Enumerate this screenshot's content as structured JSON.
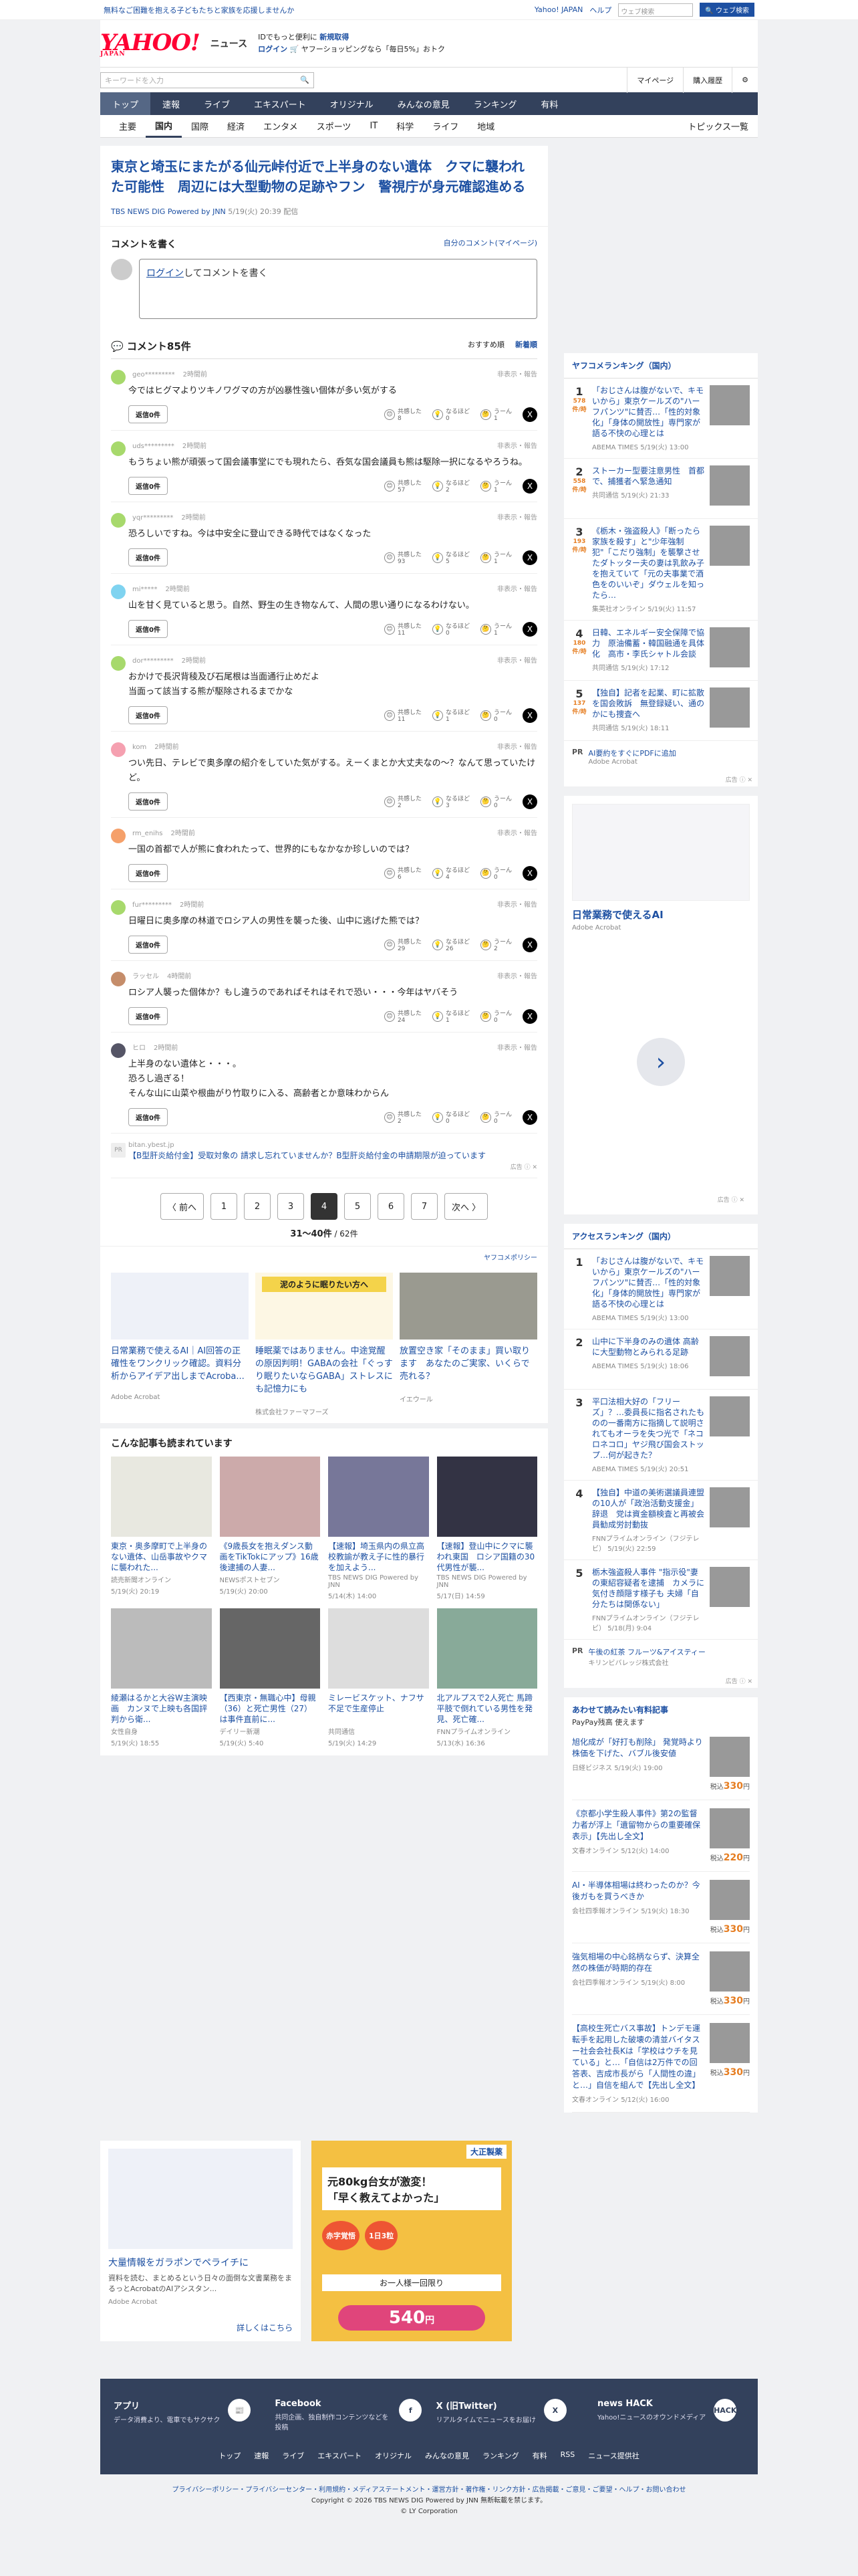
{
  "topstrip": {
    "promo": "無料なご困難を抱える子どもたちと家族を応援しませんか",
    "links": [
      "Yahoo! JAPAN",
      "ヘルプ"
    ],
    "search_placeholder": "ウェブ検索",
    "search_button": "🔍 ウェブ検索"
  },
  "masthead": {
    "logo": "YAHOO!",
    "logo_sub": "JAPAN",
    "service": "ニュース",
    "promo_line1_a": "IDでもっと便利に",
    "promo_line1_b": "新規取得",
    "promo_line2_a": "ログイン",
    "promo_line2_b": "🛒 ヤフーショッピングなら「毎日5%」おトク"
  },
  "subbar": {
    "keyword_placeholder": "キーワードを入力",
    "mypage": "マイページ",
    "purchase": "購入履歴"
  },
  "gnav": [
    "トップ",
    "速報",
    "ライブ",
    "エキスパート",
    "オリジナル",
    "みんなの意見",
    "ランキング",
    "有料"
  ],
  "cnav": {
    "items": [
      "主要",
      "国内",
      "国際",
      "経済",
      "エンタメ",
      "スポーツ",
      "IT",
      "科学",
      "ライフ",
      "地域"
    ],
    "topics_list": "トピックス一覧"
  },
  "article": {
    "title": "東京と埼玉にまたがる仙元峠付近で上半身のない遺体　クマに襲われた可能性　周辺には大型動物の足跡やフン　警視庁が身元確認進める",
    "source": "TBS NEWS DIG Powered by JNN",
    "date": "5/19(火) 20:39 配信"
  },
  "comment_form": {
    "heading": "コメントを書く",
    "own_link": "自分のコメント(マイページ)",
    "login": "ログイン",
    "placeholder_rest": "してコメントを書く"
  },
  "comments_header": {
    "title": "コメント85件",
    "sort_recommended": "おすすめ順",
    "sort_newest": "新着順"
  },
  "comments": [
    {
      "user": "geo*********",
      "age": "2時間前",
      "text": "今ではヒグマよりツキノワグマの方が凶暴性強い個体が多い気がする",
      "agree": "8",
      "naruhodo": "0",
      "umm": "1",
      "color": "#a7d96c"
    },
    {
      "user": "uds*********",
      "age": "2時間前",
      "text": "もうちょい熊が頑張って国会議事堂にでも現れたら、呑気な国会議員も熊は駆除一択になるやろうね。",
      "agree": "57",
      "naruhodo": "2",
      "umm": "1",
      "color": "#a7d96c"
    },
    {
      "user": "yqr*********",
      "age": "2時間前",
      "text": "恐ろしいですね。今は中安全に登山できる時代ではなくなった",
      "agree": "93",
      "naruhodo": "5",
      "umm": "1",
      "color": "#a7d96c"
    },
    {
      "user": "mi*****",
      "age": "2時間前",
      "text": "山を甘く見ていると思う。自然、野生の生き物なんて、人間の思い通りになるわけない。",
      "agree": "11",
      "naruhodo": "0",
      "umm": "1",
      "color": "#7fd3f0"
    },
    {
      "user": "dor*********",
      "age": "2時間前",
      "text": "おかけで長沢背稜及び石尾根は当面通行止めだよ\n当面って該当する熊が駆除されるまでかな",
      "agree": "11",
      "naruhodo": "1",
      "umm": "0",
      "color": "#a7d96c"
    },
    {
      "user": "kom",
      "age": "2時間前",
      "text": "つい先日、テレビで奥多摩の紹介をしていた気がする。えーくまとか大丈夫なの〜？なんて思っていたけど。",
      "agree": "2",
      "naruhodo": "3",
      "umm": "0",
      "color": "#f5a0b0"
    },
    {
      "user": "rm_enihs",
      "age": "2時間前",
      "text": "一国の首都で人が熊に食われたって、世界的にもなかなか珍しいのでは？",
      "agree": "6",
      "naruhodo": "4",
      "umm": "0",
      "color": "#f5a06a"
    },
    {
      "user": "fur*********",
      "age": "2時間前",
      "text": "日曜日に奥多摩の林道でロシア人の男性を襲った後、山中に逃げた熊では？",
      "agree": "29",
      "naruhodo": "26",
      "umm": "2",
      "color": "#a7d96c"
    },
    {
      "user": "ラッセル",
      "age": "4時間前",
      "text": "ロシア人襲った個体か？もし違うのであればそれはそれで恐い・・・今年はヤバそう",
      "agree": "24",
      "naruhodo": "1",
      "umm": "0",
      "color": "#c58d6a"
    },
    {
      "user": "ヒロ",
      "age": "2時間前",
      "text": "上半身のない遺体と・・・。\n恐ろし過ぎる！\nそんな山に山菜や根曲がり竹取りに入る、高齢者とか意味わからん",
      "agree": "2",
      "naruhodo": "0",
      "umm": "0",
      "color": "#556"
    }
  ],
  "labels": {
    "reply": "返信0件",
    "report": "非表示・報告",
    "agree": "共感した",
    "naruhodo": "なるほど",
    "umm": "うーん"
  },
  "inline_ad": {
    "source": "bitan.ybest.jp",
    "text": "【B型肝炎給付金】受取対象の 請求し忘れていませんか？B型肝炎給付金の申請期限が迫っています",
    "label": "広告 ⓘ ✕"
  },
  "pager": {
    "prev": "〈 前へ",
    "pages": [
      "1",
      "2",
      "3",
      "4",
      "5",
      "6",
      "7"
    ],
    "current": "4",
    "next": "次へ 〉",
    "info_range": "31〜40件",
    "info_total": "/ 62件"
  },
  "policy": "ヤフコメポリシー",
  "ad_cards": [
    {
      "title": "日常業務で使えるAI｜AI回答の正確性をワンクリック確認。資料分析からアイデア出しまでAcroba...",
      "source": "Adobe Acrobat",
      "caption": ""
    },
    {
      "title": "睡眠薬ではありません。中途覚醒の原因判明！GABAの会社「ぐっすり眠りたいならGABA」ストレスにも記憶力にも",
      "source": "株式会社ファーマフーズ",
      "caption": "泥のように眠りたい方へ"
    },
    {
      "title": "放置空き家「そのまま」買い取ります　あなたのご実家、いくらで売れる？",
      "source": "イエウール",
      "caption": ""
    }
  ],
  "read_section": {
    "title": "こんな記事も読まれています",
    "items": [
      {
        "title": "東京・奥多摩町で上半身のない遺体、山岳事故やクマに襲われた...",
        "source": "読売新聞オンライン",
        "date": "5/19(火) 20:19"
      },
      {
        "title": "《9歳長女を抱えダンス動画をTikTokにアップ》16歳後逮捕の人妻...",
        "source": "NEWSポストセブン",
        "date": "5/19(火) 20:00"
      },
      {
        "title": "【速報】埼玉県内の県立高校教諭が教え子に性的暴行を加えよう...",
        "source": "TBS NEWS DIG Powered by JNN",
        "date": "5/14(木) 14:00"
      },
      {
        "title": "【速報】登山中にクマに襲われ東国　ロシア国籍の30代男性が襲...",
        "source": "TBS NEWS DIG Powered by JNN",
        "date": "5/17(日) 14:59"
      },
      {
        "title": "綾瀬はるかと大谷W主演映画　カンヌで上映も各国評判から衛...",
        "source": "女性自身",
        "date": "5/19(火) 18:55"
      },
      {
        "title": "【西東京・無職心中】母親（36）と死亡男性（27）は事件直前に...",
        "source": "デイリー新潮",
        "date": "5/19(火) 5:40"
      },
      {
        "title": "ミレービスケット、ナフサ不足で生産停止",
        "source": "共同通信",
        "date": "5/19(火) 14:29"
      },
      {
        "title": "北アルプスで2人死亡 馬蹄平肢で倒れている男性を発見、死亡確...",
        "source": "FNNプライムオンライン",
        "date": "5/13(水) 16:36"
      }
    ]
  },
  "side": {
    "yahucome_title": "ヤフコメランキング（国内）",
    "yahucome": [
      {
        "n": "1",
        "count": "578件/時",
        "title": "「おじさんは腹がないで、キモいから」東京ケールズの\"ハーフパンツ\"に賛否…「性的対象化」「身体の開放性」専門家が語る不快の心理とは",
        "source": "ABEMA TIMES",
        "date": "5/19(火) 13:00"
      },
      {
        "n": "2",
        "count": "558件/時",
        "title": "ストーカー型要注意男性　首都で、捕獲者へ緊急通知",
        "source": "共同通信",
        "date": "5/19(火) 21:33"
      },
      {
        "n": "3",
        "count": "193件/時",
        "title": "《栃木・強盗殺人》「断ったら家族を殺す」と\"少年強制犯\"「こだり強制」を襲撃させたダトッター夫の妻は乳飲み子を抱えていて「元の夫事業で酒色をのいいぞ」ダウェルを知ったら…",
        "source": "集英社オンライン",
        "date": "5/19(火) 11:57"
      },
      {
        "n": "4",
        "count": "180件/時",
        "title": "日韓、エネルギー安全保障で協力　原油備蓄・韓国融通を具体化　高市・李氏シャトル会談",
        "source": "共同通信",
        "date": "5/19(火) 17:12"
      },
      {
        "n": "5",
        "count": "137件/時",
        "title": "【独自】記者を起業、町に拡散を国会敗訴　無登録疑い、通のかにも捜査へ",
        "source": "共同通信",
        "date": "5/19(火) 18:11"
      }
    ],
    "pr": {
      "tag": "PR",
      "title": "AI要約をすぐにPDFに追加",
      "source": "Adobe Acrobat"
    },
    "ad_label": "広告 ⓘ ✕",
    "ad": {
      "title": "日常業務で使えるAI",
      "source": "Adobe Acrobat"
    },
    "access_title": "アクセスランキング（国内）",
    "access": [
      {
        "n": "1",
        "title": "「おじさんは腹がないで、キモいから」東京ケールズの\"ハーフパンツ\"に賛否…「性的対象化」「身体的開放性」専門家が語る不快の心理とは",
        "source": "ABEMA TIMES",
        "date": "5/19(火) 13:00"
      },
      {
        "n": "2",
        "title": "山中に下半身のみの遺体 高齢に大型動物とみられる足跡",
        "source": "ABEMA TIMES",
        "date": "5/19(火) 18:06"
      },
      {
        "n": "3",
        "title": "平口法相大好の「フリーズ」？…委員長に指名されたものの一番南方に指摘して説明されてもオーラを失つ光で「ネコロネコロ」ヤジ飛び国会ストップ…何が起きた？",
        "source": "ABEMA TIMES",
        "date": "5/19(火) 20:51"
      },
      {
        "n": "4",
        "title": "【独自】中道の美術選議員連盟の10人が「政治活動支援金」辞退　党は資金額検査と再被会員勧成労討動抜",
        "source": "FNNプライムオンライン（フジテレビ）",
        "date": "5/19(火) 22:59"
      },
      {
        "n": "5",
        "title": "栃木強盗殺人事件 \"指示役\"妻の東紹容疑者を逮捕　カメラに気付き顔隠す様子も 夫婦「自分たちは関係ない」",
        "source": "FNNプライムオンライン（フジテレビ）",
        "date": "5/18(月) 9:04"
      }
    ],
    "pr2": {
      "tag": "PR",
      "title": "午後の紅茶 フルーツ&アイスティー",
      "source": "キリンビバレッジ株式会社"
    },
    "paid_title": "あわせて読みたい有料記事",
    "paid_sub": "PayPay残高 使えます",
    "paid": [
      {
        "title": "旭化成が「好打も削除」 発覚時より株価を下げた、バブル後安値",
        "source": "日経ビジネス",
        "date": "5/19(火) 19:00",
        "price": "330"
      },
      {
        "title": "《京都小学生殺人事件》第2の監督力者が浮上「遺留物からの重要確保表示」【先出し全文】",
        "source": "文春オンライン",
        "date": "5/12(火) 14:00",
        "price": "220"
      },
      {
        "title": "AI・半導体相場は終わったのか？今後ガもを買うべきか",
        "source": "会社四季報オンライン",
        "date": "5/19(火) 18:30",
        "price": "330"
      },
      {
        "title": "強気相場の中心銘柄ならず、決算全然の株価が時期的存在",
        "source": "会社四季報オンライン",
        "date": "5/19(火) 8:00",
        "price": "330"
      },
      {
        "title": "【高校生死亡バス事故】トンデモ運転手を起用した破壊の清並バイタスー社会会社長Kは「学校はウチを見ている」と…「自信は2万件での回答表、吉成市長がら「人間性の違」と…」自信を組んで【先出し全文】",
        "source": "文春オンライン",
        "date": "5/12(火) 16:00",
        "price": "330"
      }
    ]
  },
  "bottom_ads": {
    "left": {
      "title": "大量情報をガラポンでペライチに",
      "desc": "資料を読む、まとめるという日々の面倒な文書業務をまるっとAcrobatのAIアシスタン...",
      "source": "Adobe Acrobat",
      "more": "詳しくはこちら"
    },
    "right": {
      "brand": "大正製薬",
      "line1": "元80kg台女が激変！",
      "line2": "「早く教えてよかった」",
      "tag1": "赤字覚悟",
      "tag2": "1日3粒",
      "line3": "お一人様一回限り",
      "price": "540",
      "price_suffix": "円"
    }
  },
  "footer": {
    "cols": [
      {
        "title": "アプリ",
        "desc": "データ消費より、電車でもサクサク",
        "icon": "📰"
      },
      {
        "title": "Facebook",
        "desc": "共同企画、独自制作コンテンツなどを投稿",
        "icon": "f"
      },
      {
        "title": "X (旧Twitter)",
        "desc": "リアルタイムでニュースをお届け",
        "icon": "X"
      },
      {
        "title": "news HACK",
        "desc": "Yahoo!ニュースのオウンドメディア",
        "icon": "HACK"
      }
    ],
    "nav": [
      "トップ",
      "速報",
      "ライブ",
      "エキスパート",
      "オリジナル",
      "みんなの意見",
      "ランキング",
      "有料",
      "RSS",
      "ニュース提供社"
    ],
    "legal": "プライバシーポリシー・プライバシーセンター・利用規約・メディアステートメント・運営方針・著作権・リンク方針・広告掲載・ご意見・ご要望・ヘルプ・お問い合わせ",
    "copyright": "Copyright © 2026 TBS NEWS DIG Powered by JNN 無断転載を禁じます。",
    "ly": "© LY Corporation"
  }
}
